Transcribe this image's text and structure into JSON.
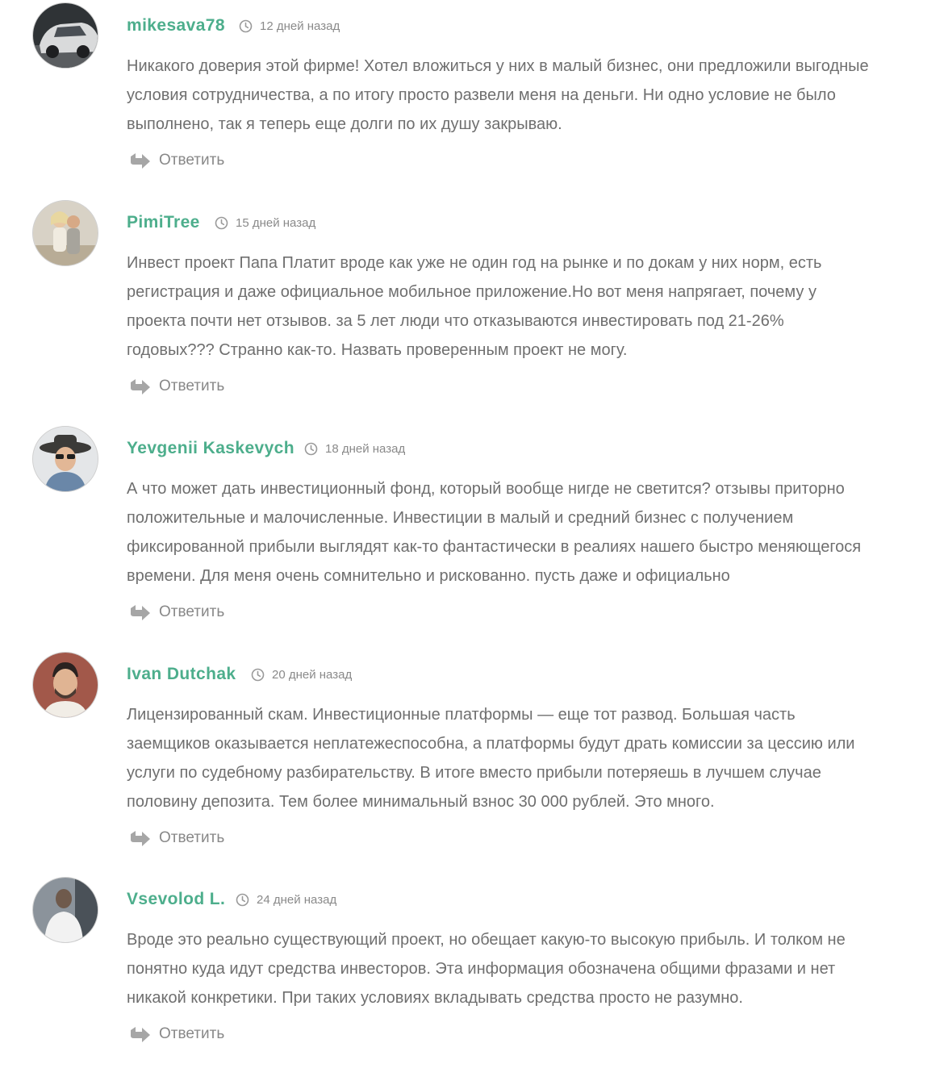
{
  "comments": [
    {
      "author": "mikesava78",
      "time": "12 дней назад",
      "text": "Никакого доверия этой фирме! Хотел вложиться у них в малый бизнес, они предложили выгодные\nусловия сотрудничества, а по итогу просто развели меня на деньги. Ни одно условие не было\nвыполнено, так я теперь еще долги по их душу закрываю.",
      "reply_label": "Ответить"
    },
    {
      "author": "PimiTree",
      "time": "15 дней назад",
      "text": "Инвест проект Папа Платит вроде как уже не один год на рынке и по докам у них норм, есть\nрегистрация и даже официальное мобильное приложение.Но вот меня напрягает, почему у\nпроекта почти нет отзывов. за 5 лет люди что отказываются инвестировать под 21-26%\nгодовых??? Странно как-то. Назвать проверенным проект не могу.",
      "reply_label": "Ответить"
    },
    {
      "author": "Yevgenii Kaskevych",
      "time": "18 дней назад",
      "text": "А что может дать инвестиционный фонд, который вообще нигде не светится? отзывы приторно\nположительные и малочисленные. Инвестиции в малый и средний бизнес с получением\nфиксированной прибыли выглядят как-то фантастически в реалиях нашего быстро меняющегося\nвремени. Для меня очень сомнительно и рискованно. пусть даже и официально",
      "reply_label": "Ответить"
    },
    {
      "author": "Ivan Dutchak",
      "time": "20 дней назад",
      "text": "Лицензированный скам. Инвестиционные платформы — еще тот развод. Большая часть\nзаемщиков оказывается неплатежеспособна, а платформы будут драть комиссии за цессию или\nуслуги по судебному разбирательству. В итоге вместо прибыли потеряешь в лучшем случае\nполовину депозита. Тем более минимальный взнос 30 000 рублей. Это много.",
      "reply_label": "Ответить"
    },
    {
      "author": "Vsevolod L.",
      "time": "24 дней назад",
      "text": "Вроде это реально существующий проект, но обещает какую-то высокую прибыль. И толком не\nпонятно куда идут средства инвесторов. Эта информация обозначена общими фразами и нет\nникакой конкретики. При таких условиях вкладывать средства просто не разумно.",
      "reply_label": "Ответить"
    }
  ],
  "icons": {
    "clock": "clock-icon",
    "reply": "reply-arrow-icon",
    "avatar": "user-avatar"
  },
  "colors": {
    "author": "#4dae8c",
    "text": "#6f6f6f",
    "muted": "#8a8a8a"
  }
}
